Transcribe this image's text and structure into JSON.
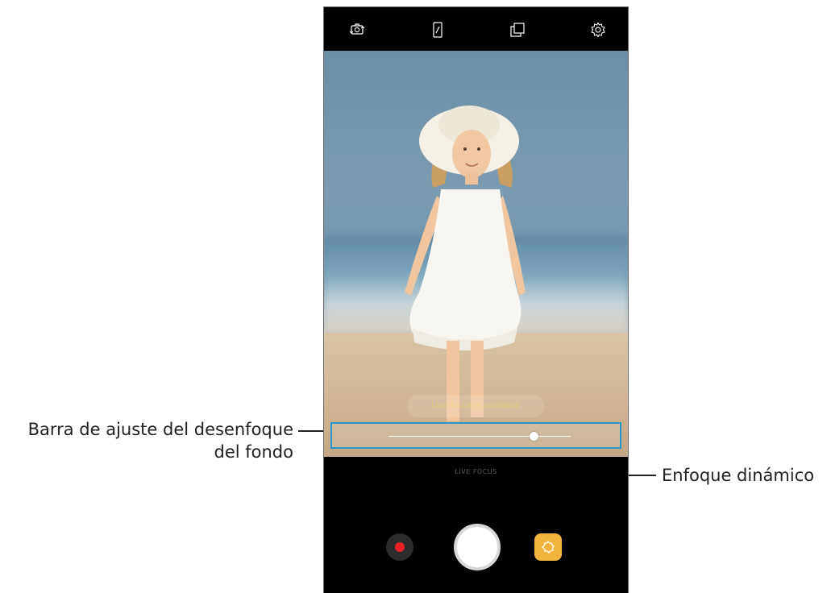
{
  "callouts": {
    "blur_bar_line1": "Barra de ajuste del desenfoque",
    "blur_bar_line2": "del fondo",
    "live_focus": "Enfoque dinámico"
  },
  "camera": {
    "top_icons": [
      "switch-camera-icon",
      "aspect-ratio-icon",
      "gallery-icon",
      "settings-icon"
    ],
    "focus_hint": "Live focus is available",
    "mode_label": "LIVE FOCUS",
    "blur_level": 0.8,
    "colors": {
      "highlight": "#2a96c8",
      "record": "#e8212a",
      "effect": "#f2b33d"
    }
  }
}
